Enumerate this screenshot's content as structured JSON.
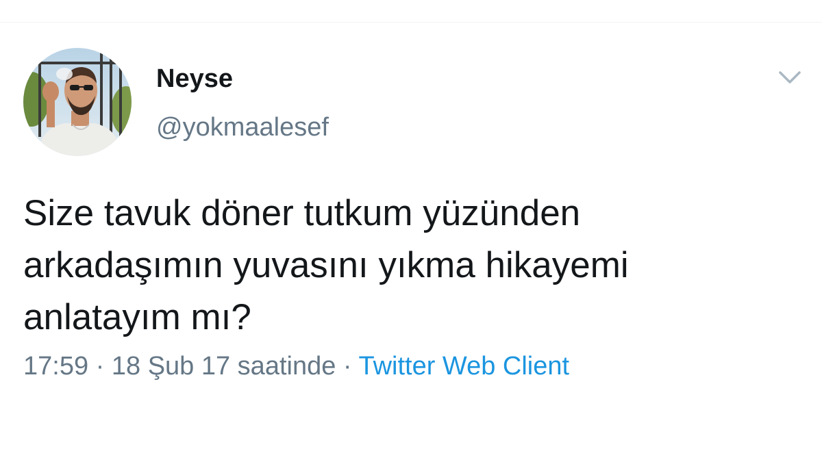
{
  "tweet": {
    "author": {
      "display_name": "Neyse",
      "handle": "@yokmaalesef",
      "avatar_icon": "user-avatar-photo"
    },
    "menu_icon": "chevron-down-icon",
    "text": "Size tavuk döner tutkum yüzünden\narkadaşımın yuvasını yıkma hikayemi\nanlatayım mı?",
    "timestamp": "17:59 · 18 Şub 17 saatinde",
    "separator": " · ",
    "client": "Twitter Web Client"
  },
  "colors": {
    "text_primary": "#14171a",
    "text_secondary": "#657786",
    "link": "#1b95e0",
    "icon": "#aab8c2"
  }
}
